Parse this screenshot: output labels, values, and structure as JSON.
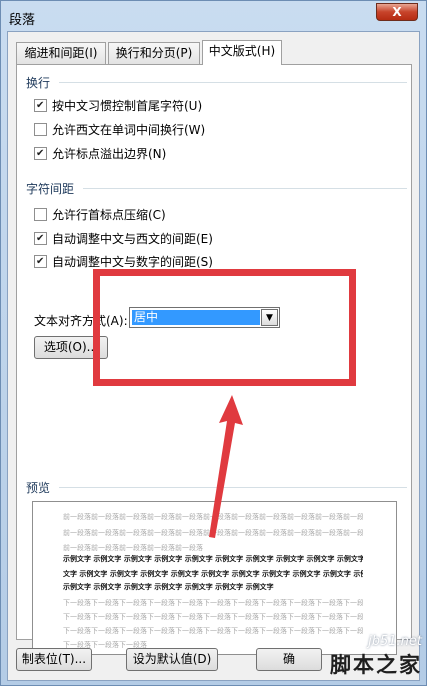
{
  "window": {
    "title": "段落",
    "close_glyph": "X"
  },
  "tabs": [
    {
      "label": "缩进和间距(I)"
    },
    {
      "label": "换行和分页(P)"
    },
    {
      "label": "中文版式(H)"
    }
  ],
  "line_break": {
    "heading": "换行",
    "options": [
      {
        "label": "按中文习惯控制首尾字符(U)",
        "checked": true
      },
      {
        "label": "允许西文在单词中间换行(W)",
        "checked": false
      },
      {
        "label": "允许标点溢出边界(N)",
        "checked": true
      }
    ]
  },
  "char_spacing": {
    "heading": "字符间距",
    "options": [
      {
        "label": "允许行首标点压缩(C)",
        "checked": false
      },
      {
        "label": "自动调整中文与西文的间距(E)",
        "checked": true
      },
      {
        "label": "自动调整中文与数字的间距(S)",
        "checked": true
      }
    ],
    "align_label": "文本对齐方式(A):",
    "align_value": "居中",
    "options_button": "选项(O)..."
  },
  "preview": {
    "heading": "预览",
    "lines": [
      "前一段落前一段落前一段落前一段落前一段落前一段落前一段落前一段落前一段落前一段落前一段落前一段落前一段落",
      "前一段落前一段落前一段落前一段落前一段落前一段落前一段落前一段落前一段落前一段落前一段落前一段落前一段落",
      "前一段落前一段落前一段落前一段落前一段落",
      "示例文字 示例文字 示例文字 示例文字 示例文字 示例文字 示例文字 示例文字 示例文字 示例文字",
      "文字 示例文字 示例文字 示例文字 示例文字 示例文字 示例文字 示例文字 示例文字 示例文字 示例",
      "示例文字 示例文字 示例文字 示例文字 示例文字 示例文字 示例文字",
      "下一段落下一段落下一段落下一段落下一段落下一段落下一段落下一段落下一段落下一段落下一段落下一段落",
      "下一段落下一段落下一段落下一段落下一段落下一段落下一段落下一段落下一段落下一段落下一段落下一段落下一段落",
      "下一段落下一段落下一段落下一段落下一段落下一段落下一段落下一段落下一段落下一段落下一段落下一段落下一段落",
      "下一段落下一段落下一段落"
    ]
  },
  "footer": {
    "tabs_button": "制表位(T)...",
    "default_button": "设为默认值(D)",
    "ok_button": "确"
  },
  "watermark": {
    "domain": "jb51.net",
    "brand": "脚本之家"
  },
  "colors": {
    "highlight": "#e03a3f",
    "selection": "#3399ff"
  }
}
